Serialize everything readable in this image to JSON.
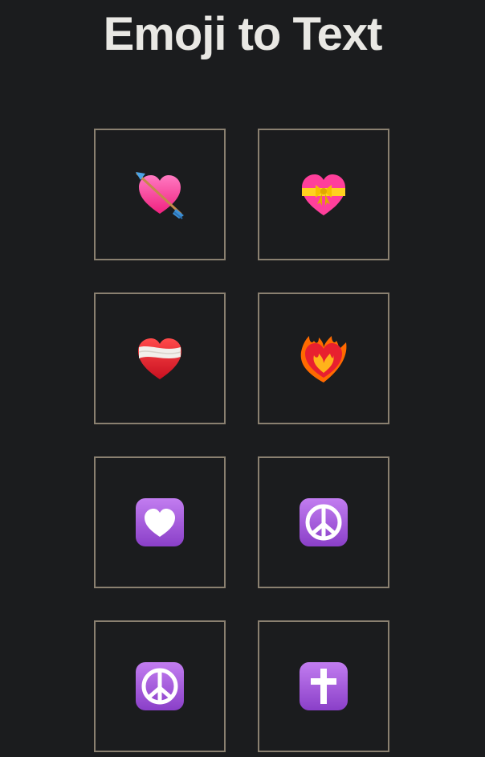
{
  "header": {
    "title": "Emoji to Text"
  },
  "grid": {
    "items": [
      {
        "icon": "heart-with-arrow-icon"
      },
      {
        "icon": "heart-with-ribbon-icon"
      },
      {
        "icon": "mending-heart-icon"
      },
      {
        "icon": "heart-on-fire-icon"
      },
      {
        "icon": "white-heart-purple-square-icon"
      },
      {
        "icon": "peace-symbol-icon"
      },
      {
        "icon": "peace-symbol-icon"
      },
      {
        "icon": "latin-cross-icon"
      }
    ]
  },
  "colors": {
    "background": "#1b1c1e",
    "title_text": "#e9e8e4",
    "tile_border": "#8a8070",
    "purple_square": "#a15ad8",
    "pink_heart": "#ff3f9b",
    "red_heart": "#e8202f"
  }
}
